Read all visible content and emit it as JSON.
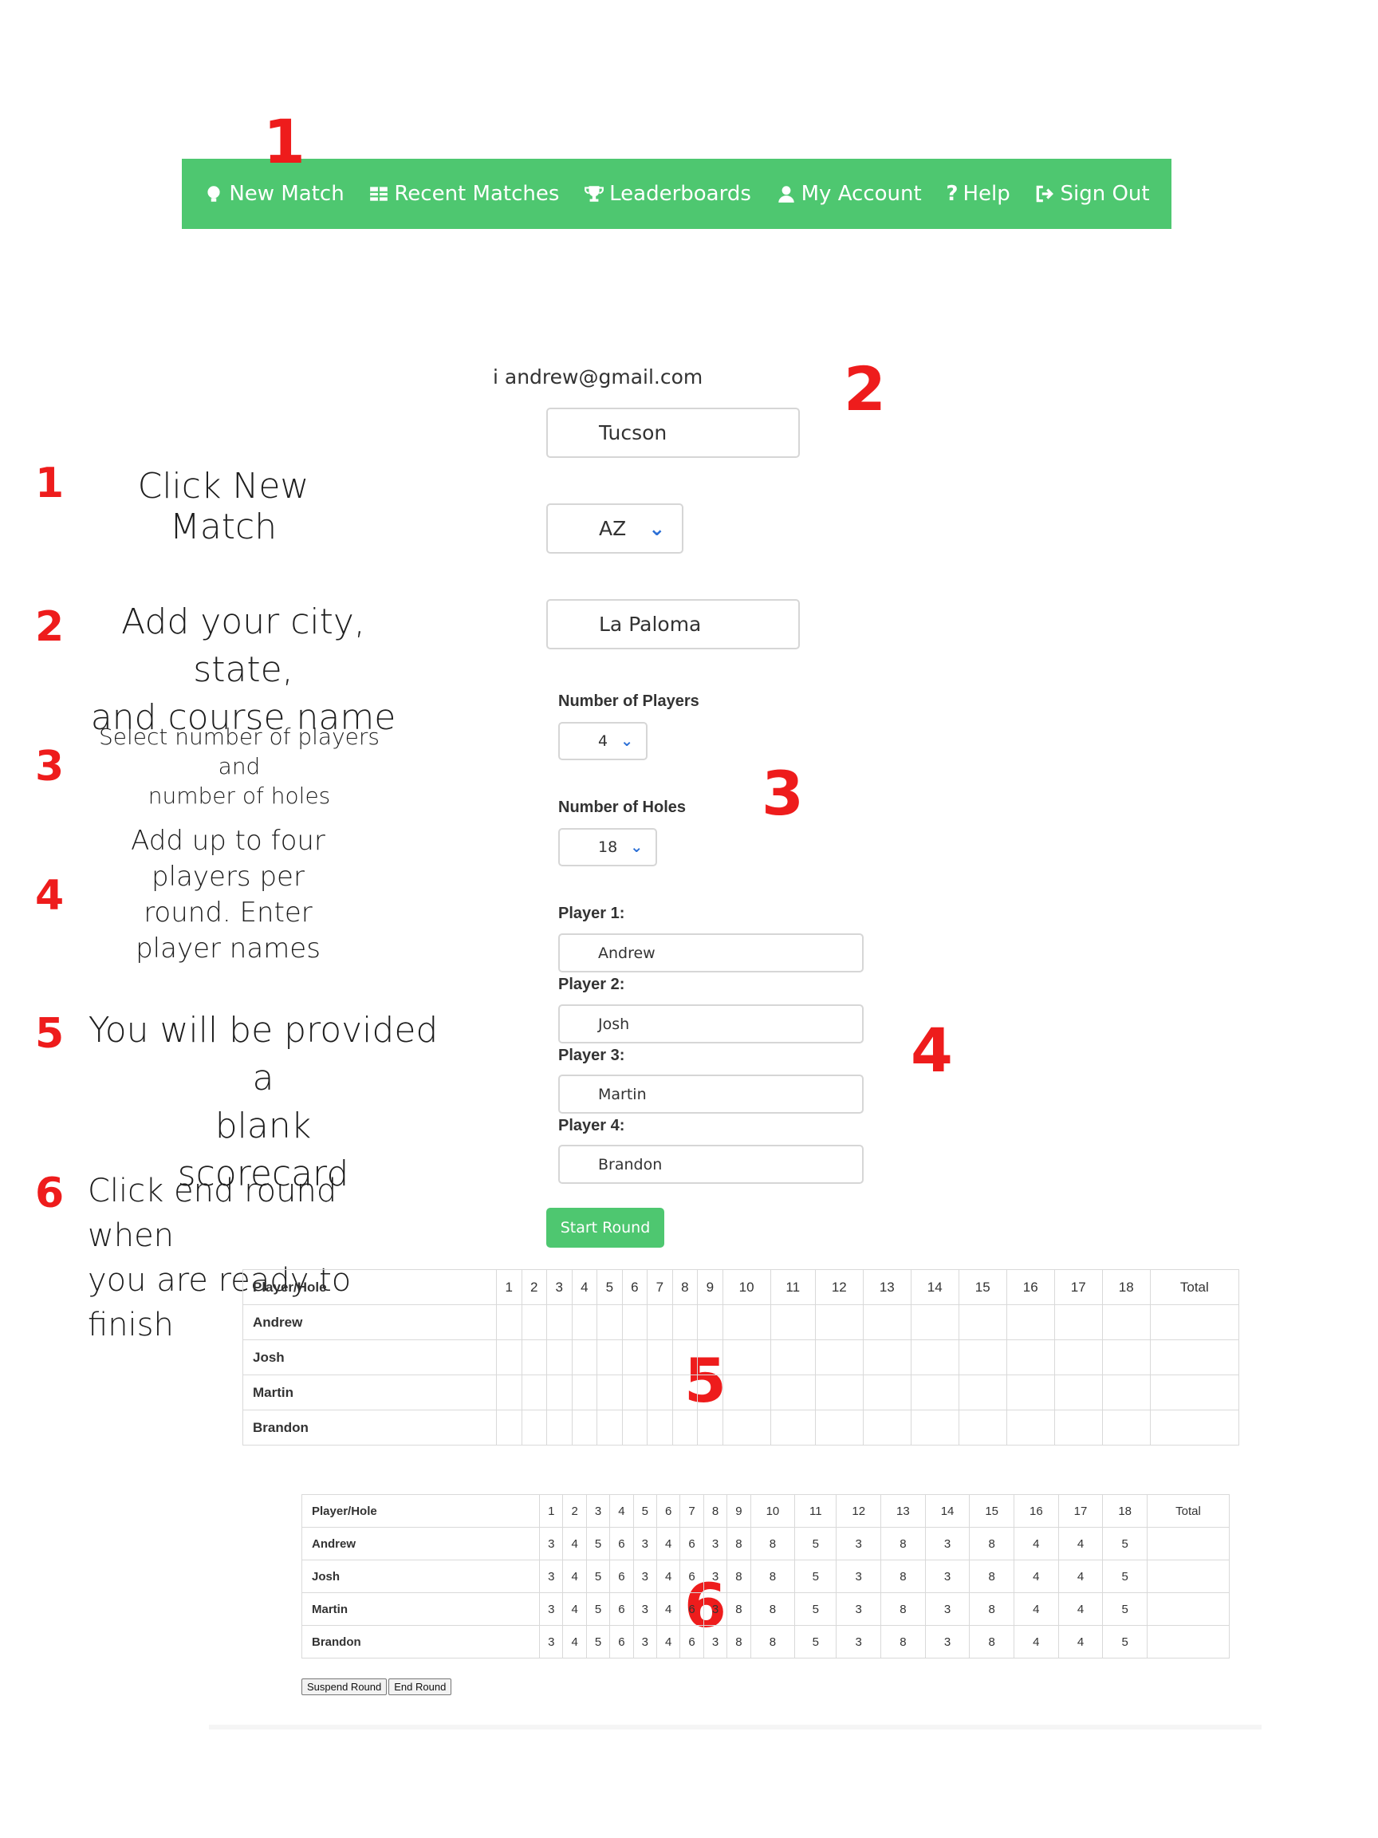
{
  "nav": {
    "items": [
      {
        "label": "New Match",
        "icon": "lightbulb-icon"
      },
      {
        "label": "Recent Matches",
        "icon": "table-icon"
      },
      {
        "label": "Leaderboards",
        "icon": "trophy-icon"
      },
      {
        "label": "My Account",
        "icon": "user-icon"
      },
      {
        "label": "Help",
        "icon": "question-icon"
      },
      {
        "label": "Sign Out",
        "icon": "sign-out-icon"
      }
    ]
  },
  "steps": {
    "n1": "1",
    "n2": "2",
    "n3": "3",
    "n4": "4",
    "n5": "5",
    "n6": "6"
  },
  "instructions": {
    "s1": "Click New Match",
    "s2_line1": "Add your city, state,",
    "s2_line2": "and course name",
    "s3_line1": "Select number of players and",
    "s3_line2": "number of holes",
    "s4_line1": "Add up to four",
    "s4_line2": "players per",
    "s4_line3": "round. Enter",
    "s4_line4": "player names",
    "s5_line1": "You will be provided a",
    "s5_line2": "blank",
    "s5_line3": "scorecard",
    "s6_line1": "Click end round when",
    "s6_line2": "you are ready to finish"
  },
  "form": {
    "user_email": "i andrew@gmail.com",
    "city": "Tucson",
    "state": "AZ",
    "course": "La Paloma",
    "players_label": "Number of Players",
    "players_value": "4",
    "holes_label": "Number of Holes",
    "holes_value": "18",
    "player1_label": "Player 1:",
    "player1": "Andrew",
    "player2_label": "Player 2:",
    "player2": "Josh",
    "player3_label": "Player 3:",
    "player3": "Martin",
    "player4_label": "Player 4:",
    "player4": "Brandon",
    "start_label": "Start Round"
  },
  "scorecard_blank": {
    "header": [
      "Player/Hole",
      "1",
      "2",
      "3",
      "4",
      "5",
      "6",
      "7",
      "8",
      "9",
      "10",
      "11",
      "12",
      "13",
      "14",
      "15",
      "16",
      "17",
      "18",
      "Total"
    ],
    "players": [
      "Andrew",
      "Josh",
      "Martin",
      "Brandon"
    ]
  },
  "scorecard_filled": {
    "header": [
      "Player/Hole",
      "1",
      "2",
      "3",
      "4",
      "5",
      "6",
      "7",
      "8",
      "9",
      "10",
      "11",
      "12",
      "13",
      "14",
      "15",
      "16",
      "17",
      "18",
      "Total"
    ],
    "rows": [
      {
        "player": "Andrew",
        "scores": [
          "3",
          "4",
          "5",
          "6",
          "3",
          "4",
          "6",
          "3",
          "8",
          "8",
          "5",
          "3",
          "8",
          "3",
          "8",
          "4",
          "4",
          "5"
        ],
        "total": ""
      },
      {
        "player": "Josh",
        "scores": [
          "3",
          "4",
          "5",
          "6",
          "3",
          "4",
          "6",
          "3",
          "8",
          "8",
          "5",
          "3",
          "8",
          "3",
          "8",
          "4",
          "4",
          "5"
        ],
        "total": ""
      },
      {
        "player": "Martin",
        "scores": [
          "3",
          "4",
          "5",
          "6",
          "3",
          "4",
          "6",
          "3",
          "8",
          "8",
          "5",
          "3",
          "8",
          "3",
          "8",
          "4",
          "4",
          "5"
        ],
        "total": ""
      },
      {
        "player": "Brandon",
        "scores": [
          "3",
          "4",
          "5",
          "6",
          "3",
          "4",
          "6",
          "3",
          "8",
          "8",
          "5",
          "3",
          "8",
          "3",
          "8",
          "4",
          "4",
          "5"
        ],
        "total": ""
      }
    ],
    "suspend_label": "Suspend Round",
    "end_label": "End Round"
  },
  "colors": {
    "nav_green": "#4ec770",
    "accent_red": "#ee1c1c",
    "chevron_blue": "#2b6fd6"
  }
}
